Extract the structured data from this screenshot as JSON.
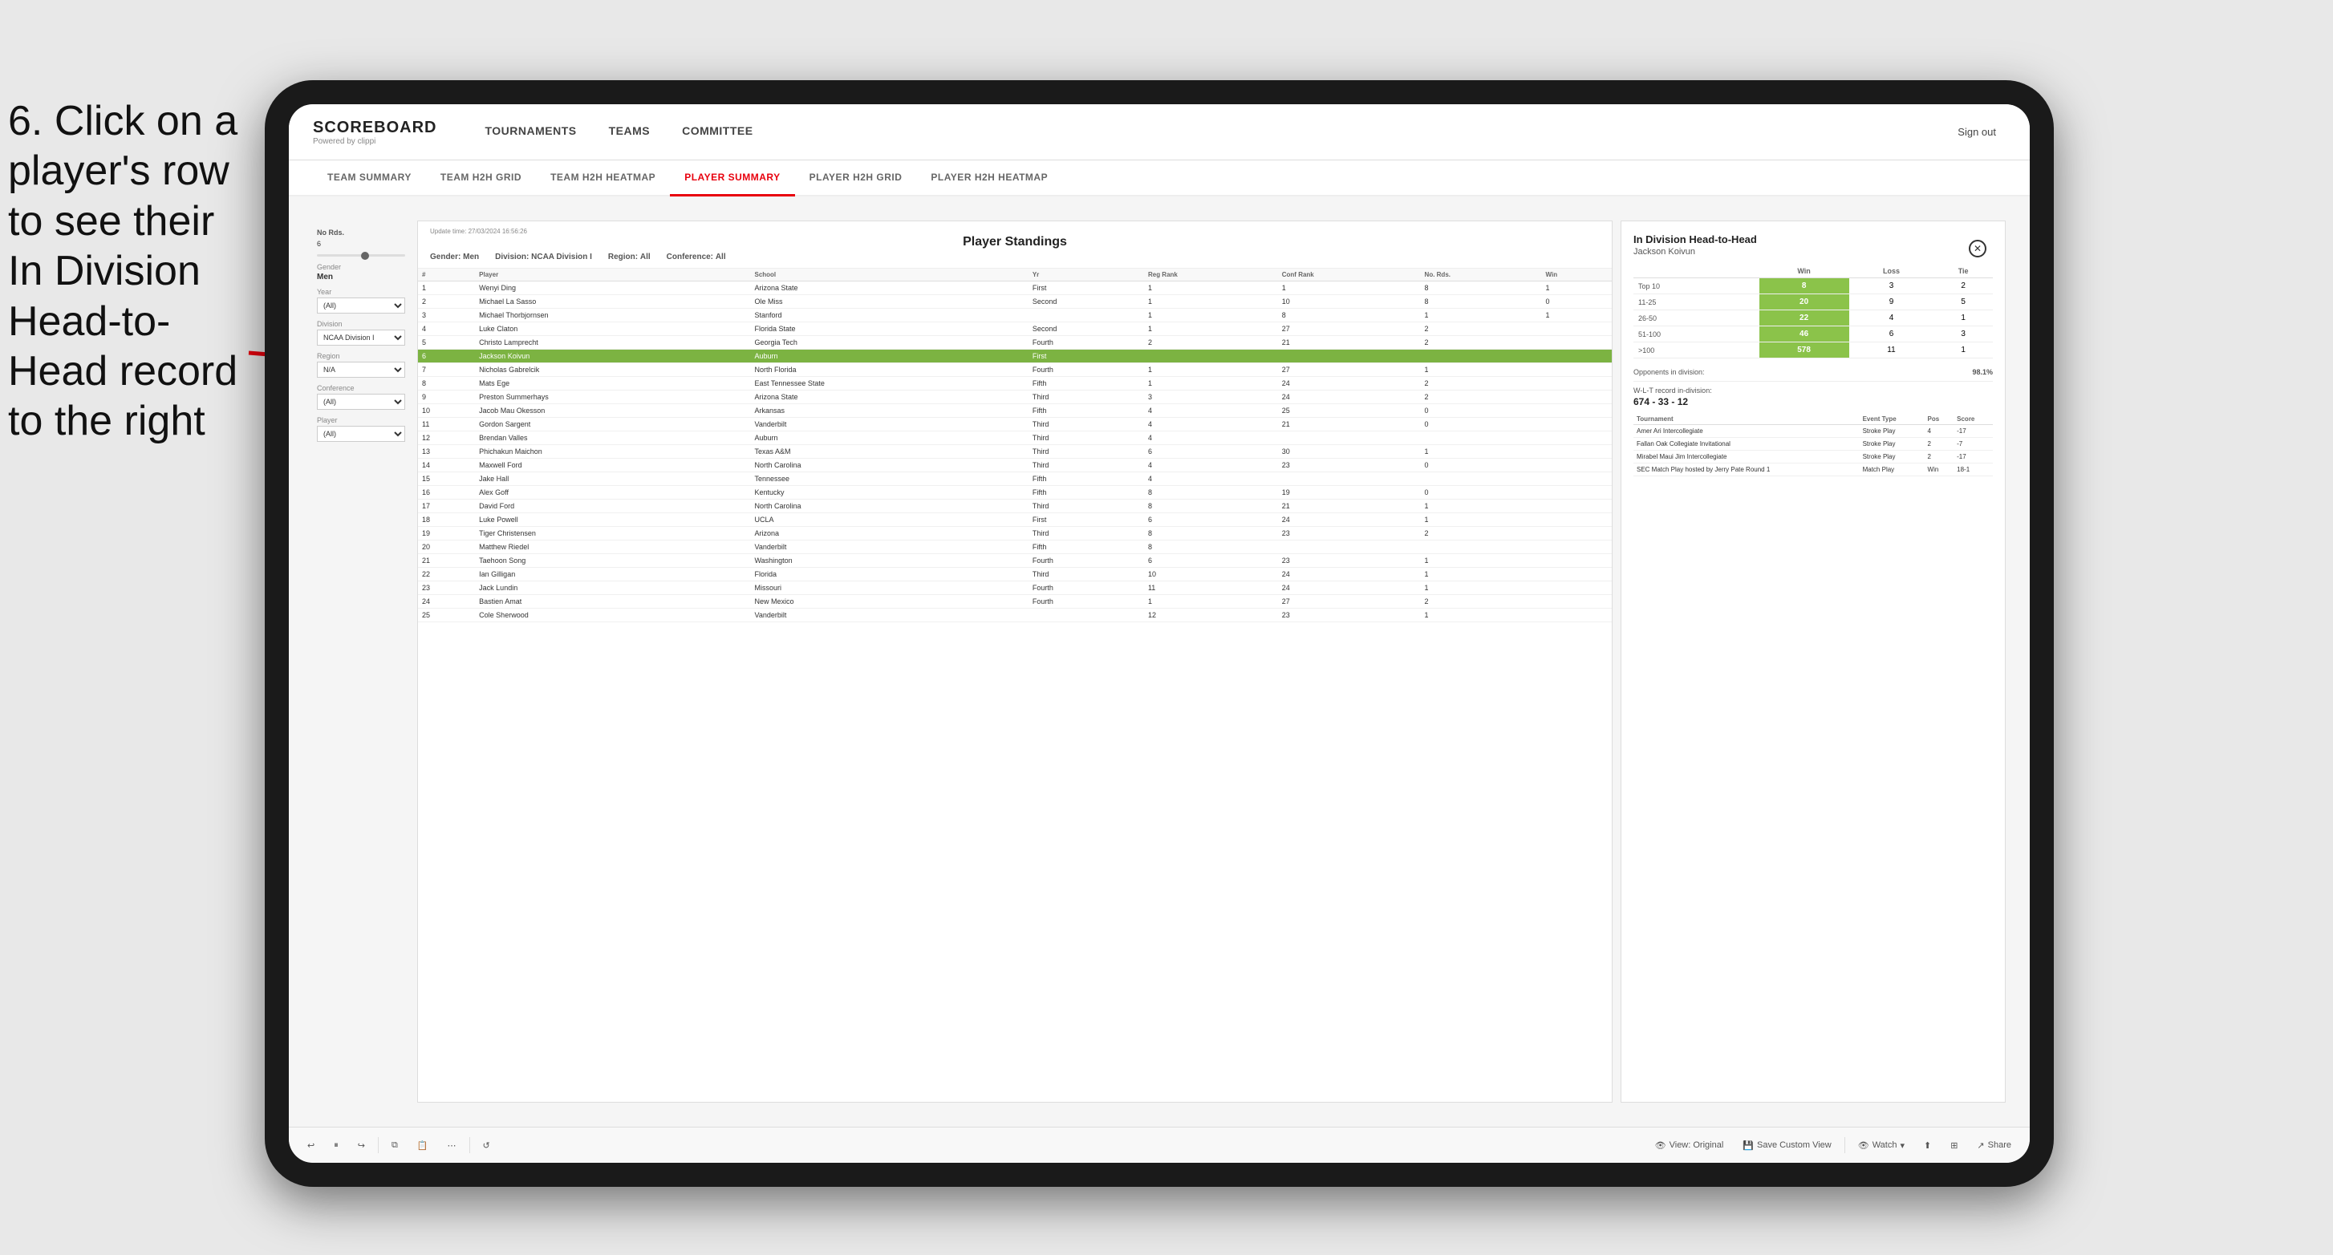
{
  "instruction": {
    "text": "6. Click on a player's row to see their In Division Head-to-Head record to the right"
  },
  "nav": {
    "logo": "SCOREBOARD",
    "logo_sub": "Powered by clippi",
    "items": [
      "TOURNAMENTS",
      "TEAMS",
      "COMMITTEE"
    ],
    "sign_out": "Sign out"
  },
  "sub_nav": {
    "items": [
      "TEAM SUMMARY",
      "TEAM H2H GRID",
      "TEAM H2H HEATMAP",
      "PLAYER SUMMARY",
      "PLAYER H2H GRID",
      "PLAYER H2H HEATMAP"
    ],
    "active": "PLAYER SUMMARY"
  },
  "filters": {
    "no_rds_label": "No Rds.",
    "no_rds_value": "6",
    "gender_label": "Gender",
    "gender_value": "Men",
    "year_label": "Year",
    "year_value": "(All)",
    "division_label": "Division",
    "division_value": "NCAA Division I",
    "region_label": "Region",
    "region_value": "N/A",
    "conference_label": "Conference",
    "conference_value": "(All)",
    "player_label": "Player",
    "player_value": "(All)"
  },
  "standings": {
    "title": "Player Standings",
    "update_label": "Update time:",
    "update_time": "27/03/2024 16:56:26",
    "gender_label": "Gender:",
    "gender_value": "Men",
    "division_label": "Division:",
    "division_value": "NCAA Division I",
    "region_label": "Region:",
    "region_value": "All",
    "conference_label": "Conference:",
    "conference_value": "All",
    "columns": [
      "#",
      "Player",
      "School",
      "Yr",
      "Reg Rank",
      "Conf Rank",
      "No. Rds.",
      "Win"
    ],
    "rows": [
      {
        "num": "1",
        "player": "Wenyi Ding",
        "school": "Arizona State",
        "yr": "First",
        "reg": "1",
        "conf": "1",
        "rds": "8",
        "win": "1"
      },
      {
        "num": "2",
        "player": "Michael La Sasso",
        "school": "Ole Miss",
        "yr": "Second",
        "reg": "1",
        "conf": "10",
        "rds": "8",
        "win": "0"
      },
      {
        "num": "3",
        "player": "Michael Thorbjornsen",
        "school": "Stanford",
        "yr": "",
        "reg": "1",
        "conf": "8",
        "rds": "1",
        "win": "1"
      },
      {
        "num": "4",
        "player": "Luke Claton",
        "school": "Florida State",
        "yr": "Second",
        "reg": "1",
        "conf": "27",
        "rds": "2",
        "win": ""
      },
      {
        "num": "5",
        "player": "Christo Lamprecht",
        "school": "Georgia Tech",
        "yr": "Fourth",
        "reg": "2",
        "conf": "21",
        "rds": "2",
        "win": ""
      },
      {
        "num": "6",
        "player": "Jackson Koivun",
        "school": "Auburn",
        "yr": "First",
        "reg": "",
        "conf": "",
        "rds": "",
        "win": "",
        "highlighted": true
      },
      {
        "num": "7",
        "player": "Nicholas Gabrelcik",
        "school": "North Florida",
        "yr": "Fourth",
        "reg": "1",
        "conf": "27",
        "rds": "1",
        "win": ""
      },
      {
        "num": "8",
        "player": "Mats Ege",
        "school": "East Tennessee State",
        "yr": "Fifth",
        "reg": "1",
        "conf": "24",
        "rds": "2",
        "win": ""
      },
      {
        "num": "9",
        "player": "Preston Summerhays",
        "school": "Arizona State",
        "yr": "Third",
        "reg": "3",
        "conf": "24",
        "rds": "2",
        "win": ""
      },
      {
        "num": "10",
        "player": "Jacob Mau Okesson",
        "school": "Arkansas",
        "yr": "Fifth",
        "reg": "4",
        "conf": "25",
        "rds": "0",
        "win": ""
      },
      {
        "num": "11",
        "player": "Gordon Sargent",
        "school": "Vanderbilt",
        "yr": "Third",
        "reg": "4",
        "conf": "21",
        "rds": "0",
        "win": ""
      },
      {
        "num": "12",
        "player": "Brendan Valles",
        "school": "Auburn",
        "yr": "Third",
        "reg": "4",
        "conf": "",
        "rds": "",
        "win": ""
      },
      {
        "num": "13",
        "player": "Phichakun Maichon",
        "school": "Texas A&M",
        "yr": "Third",
        "reg": "6",
        "conf": "30",
        "rds": "1",
        "win": ""
      },
      {
        "num": "14",
        "player": "Maxwell Ford",
        "school": "North Carolina",
        "yr": "Third",
        "reg": "4",
        "conf": "23",
        "rds": "0",
        "win": ""
      },
      {
        "num": "15",
        "player": "Jake Hall",
        "school": "Tennessee",
        "yr": "Fifth",
        "reg": "4",
        "conf": "",
        "rds": "",
        "win": ""
      },
      {
        "num": "16",
        "player": "Alex Goff",
        "school": "Kentucky",
        "yr": "Fifth",
        "reg": "8",
        "conf": "19",
        "rds": "0",
        "win": ""
      },
      {
        "num": "17",
        "player": "David Ford",
        "school": "North Carolina",
        "yr": "Third",
        "reg": "8",
        "conf": "21",
        "rds": "1",
        "win": ""
      },
      {
        "num": "18",
        "player": "Luke Powell",
        "school": "UCLA",
        "yr": "First",
        "reg": "6",
        "conf": "24",
        "rds": "1",
        "win": ""
      },
      {
        "num": "19",
        "player": "Tiger Christensen",
        "school": "Arizona",
        "yr": "Third",
        "reg": "8",
        "conf": "23",
        "rds": "2",
        "win": ""
      },
      {
        "num": "20",
        "player": "Matthew Riedel",
        "school": "Vanderbilt",
        "yr": "Fifth",
        "reg": "8",
        "conf": "",
        "rds": "",
        "win": ""
      },
      {
        "num": "21",
        "player": "Taehoon Song",
        "school": "Washington",
        "yr": "Fourth",
        "reg": "6",
        "conf": "23",
        "rds": "1",
        "win": ""
      },
      {
        "num": "22",
        "player": "Ian Gilligan",
        "school": "Florida",
        "yr": "Third",
        "reg": "10",
        "conf": "24",
        "rds": "1",
        "win": ""
      },
      {
        "num": "23",
        "player": "Jack Lundin",
        "school": "Missouri",
        "yr": "Fourth",
        "reg": "11",
        "conf": "24",
        "rds": "1",
        "win": ""
      },
      {
        "num": "24",
        "player": "Bastien Amat",
        "school": "New Mexico",
        "yr": "Fourth",
        "reg": "1",
        "conf": "27",
        "rds": "2",
        "win": ""
      },
      {
        "num": "25",
        "player": "Cole Sherwood",
        "school": "Vanderbilt",
        "yr": "",
        "reg": "12",
        "conf": "23",
        "rds": "1",
        "win": ""
      }
    ]
  },
  "h2h_panel": {
    "title": "In Division Head-to-Head",
    "player_name": "Jackson Koivun",
    "col_win": "Win",
    "col_loss": "Loss",
    "col_tie": "Tie",
    "rows": [
      {
        "label": "Top 10",
        "win": "8",
        "loss": "3",
        "tie": "2"
      },
      {
        "label": "11-25",
        "win": "20",
        "loss": "9",
        "tie": "5"
      },
      {
        "label": "26-50",
        "win": "22",
        "loss": "4",
        "tie": "1"
      },
      {
        "label": "51-100",
        "win": "46",
        "loss": "6",
        "tie": "3"
      },
      {
        ">100": ">100",
        "label": ">100",
        "win": "578",
        "loss": "11",
        "tie": "1"
      }
    ],
    "opponents_label": "Opponents in division:",
    "opponents_value": "98.1%",
    "wlt_label": "W-L-T record in-division:",
    "wlt_value": "674 - 33 - 12",
    "tournament_columns": [
      "Tournament",
      "Event Type",
      "Pos",
      "Score"
    ],
    "tournament_rows": [
      {
        "tournament": "Amer Ari Intercollegiate",
        "type": "Stroke Play",
        "pos": "4",
        "score": "-17"
      },
      {
        "tournament": "Fallan Oak Collegiate Invitational",
        "type": "Stroke Play",
        "pos": "2",
        "score": "-7"
      },
      {
        "tournament": "Mirabel Maui Jim Intercollegiate",
        "type": "Stroke Play",
        "pos": "2",
        "score": "-17"
      },
      {
        "tournament": "SEC Match Play hosted by Jerry Pate Round 1",
        "type": "Match Play",
        "pos": "Win",
        "score": "18-1"
      }
    ]
  },
  "toolbar": {
    "view_original": "View: Original",
    "save_custom": "Save Custom View",
    "watch": "Watch",
    "share": "Share"
  }
}
